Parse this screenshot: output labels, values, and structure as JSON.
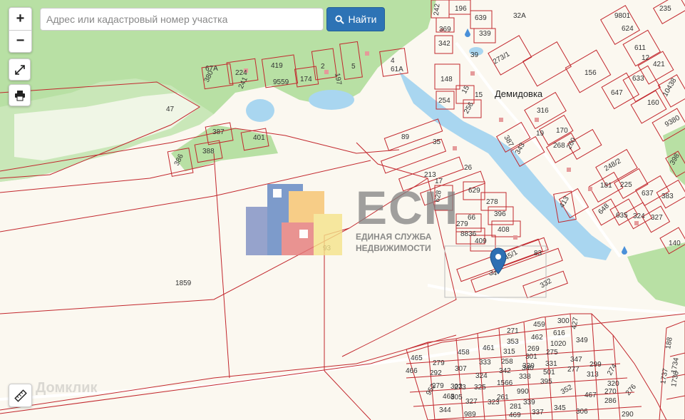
{
  "search": {
    "placeholder": "Адрес или кадастровый номер участка",
    "button_label": "Найти"
  },
  "controls": {
    "zoom_in": "+",
    "zoom_out": "−"
  },
  "map": {
    "place_name": "Демидовка",
    "plots": [
      {
        "id": "p1",
        "label": "47"
      },
      {
        "id": "p2",
        "label": "67A"
      },
      {
        "id": "p3",
        "label": "380"
      },
      {
        "id": "p4",
        "label": "224"
      },
      {
        "id": "p5",
        "label": "241"
      },
      {
        "id": "p6",
        "label": "419"
      },
      {
        "id": "p7",
        "label": "9559"
      },
      {
        "id": "p8",
        "label": "174"
      },
      {
        "id": "p9",
        "label": "2"
      },
      {
        "id": "p10",
        "label": "197"
      },
      {
        "id": "p11",
        "label": "5"
      },
      {
        "id": "p12",
        "label": "4"
      },
      {
        "id": "p13",
        "label": "61A"
      },
      {
        "id": "p14",
        "label": "387"
      },
      {
        "id": "p15",
        "label": "401"
      },
      {
        "id": "p16",
        "label": "388"
      },
      {
        "id": "p17",
        "label": "386"
      },
      {
        "id": "p18",
        "label": "242"
      },
      {
        "id": "p19",
        "label": "196"
      },
      {
        "id": "p20",
        "label": "639"
      },
      {
        "id": "p21",
        "label": "369"
      },
      {
        "id": "p22",
        "label": "339"
      },
      {
        "id": "p23",
        "label": "342"
      },
      {
        "id": "p24",
        "label": "39"
      },
      {
        "id": "p25",
        "label": "273/1"
      },
      {
        "id": "p26",
        "label": "148"
      },
      {
        "id": "p27",
        "label": "254"
      },
      {
        "id": "p28",
        "label": "15"
      },
      {
        "id": "p29",
        "label": "256"
      },
      {
        "id": "p30",
        "label": "32A"
      },
      {
        "id": "p31",
        "label": "9801"
      },
      {
        "id": "p32",
        "label": "624"
      },
      {
        "id": "p33",
        "label": "611"
      },
      {
        "id": "p34",
        "label": "12"
      },
      {
        "id": "p35",
        "label": "421"
      },
      {
        "id": "p36",
        "label": "156"
      },
      {
        "id": "p37",
        "label": "647"
      },
      {
        "id": "p38",
        "label": "633"
      },
      {
        "id": "p39",
        "label": "10438"
      },
      {
        "id": "p40",
        "label": "235"
      },
      {
        "id": "p41",
        "label": "316"
      },
      {
        "id": "p42",
        "label": "160"
      },
      {
        "id": "p43",
        "label": "9380"
      },
      {
        "id": "p44",
        "label": "387"
      },
      {
        "id": "p45",
        "label": "170"
      },
      {
        "id": "p46",
        "label": "19"
      },
      {
        "id": "p47",
        "label": "343"
      },
      {
        "id": "p48",
        "label": "268"
      },
      {
        "id": "p49",
        "label": "260"
      },
      {
        "id": "p50",
        "label": "248/2"
      },
      {
        "id": "p51",
        "label": "398"
      },
      {
        "id": "p52",
        "label": "89"
      },
      {
        "id": "p53",
        "label": "213"
      },
      {
        "id": "p54",
        "label": "17"
      },
      {
        "id": "p55",
        "label": "628"
      },
      {
        "id": "p56",
        "label": "629"
      },
      {
        "id": "p57",
        "label": "278"
      },
      {
        "id": "p58",
        "label": "279"
      },
      {
        "id": "p59",
        "label": "396"
      },
      {
        "id": "p60",
        "label": "8836"
      },
      {
        "id": "p61",
        "label": "408"
      },
      {
        "id": "p62",
        "label": "409"
      },
      {
        "id": "p63",
        "label": "181"
      },
      {
        "id": "p64",
        "label": "225"
      },
      {
        "id": "p65",
        "label": "637"
      },
      {
        "id": "p66",
        "label": "383"
      },
      {
        "id": "p67",
        "label": "413"
      },
      {
        "id": "p68",
        "label": "648"
      },
      {
        "id": "p69",
        "label": "635"
      },
      {
        "id": "p70",
        "label": "324"
      },
      {
        "id": "p71",
        "label": "327"
      },
      {
        "id": "p72",
        "label": "140"
      },
      {
        "id": "p73",
        "label": "93"
      },
      {
        "id": "p74",
        "label": "83"
      },
      {
        "id": "p75",
        "label": "345/1"
      },
      {
        "id": "p76",
        "label": "34"
      },
      {
        "id": "p77",
        "label": "332"
      },
      {
        "id": "p78",
        "label": "1859"
      },
      {
        "id": "p79",
        "label": "459"
      },
      {
        "id": "p80",
        "label": "300"
      },
      {
        "id": "p81",
        "label": "427"
      },
      {
        "id": "p82",
        "label": "271"
      },
      {
        "id": "p83",
        "label": "462"
      },
      {
        "id": "p84",
        "label": "616"
      },
      {
        "id": "p85",
        "label": "349"
      },
      {
        "id": "p86",
        "label": "353"
      },
      {
        "id": "p87",
        "label": "269"
      },
      {
        "id": "p88",
        "label": "1020"
      },
      {
        "id": "p89",
        "label": "461"
      },
      {
        "id": "p90",
        "label": "315"
      },
      {
        "id": "p91",
        "label": "275"
      },
      {
        "id": "p92",
        "label": "458"
      },
      {
        "id": "p93",
        "label": "301"
      },
      {
        "id": "p94",
        "label": "347"
      },
      {
        "id": "p95",
        "label": "299"
      },
      {
        "id": "p96",
        "label": "465"
      },
      {
        "id": "p97",
        "label": "279"
      },
      {
        "id": "p98",
        "label": "258"
      },
      {
        "id": "p99",
        "label": "330"
      },
      {
        "id": "p100",
        "label": "331"
      },
      {
        "id": "p101",
        "label": "277"
      },
      {
        "id": "p102",
        "label": "333"
      },
      {
        "id": "p103",
        "label": "307"
      },
      {
        "id": "p104",
        "label": "342"
      },
      {
        "id": "p105",
        "label": "340"
      },
      {
        "id": "p106",
        "label": "501"
      },
      {
        "id": "p107",
        "label": "313"
      },
      {
        "id": "p108",
        "label": "274"
      },
      {
        "id": "p109",
        "label": "466"
      },
      {
        "id": "p110",
        "label": "292"
      },
      {
        "id": "p111",
        "label": "324"
      },
      {
        "id": "p112",
        "label": "338"
      },
      {
        "id": "p113",
        "label": "395"
      },
      {
        "id": "p114",
        "label": "279"
      },
      {
        "id": "p115",
        "label": "320"
      },
      {
        "id": "p116",
        "label": "1737"
      },
      {
        "id": "p117",
        "label": "1734"
      },
      {
        "id": "p118",
        "label": "188"
      },
      {
        "id": "p119",
        "label": "273"
      },
      {
        "id": "p120",
        "label": "1566"
      },
      {
        "id": "p121",
        "label": "325"
      },
      {
        "id": "p122",
        "label": "990"
      },
      {
        "id": "p123",
        "label": "352"
      },
      {
        "id": "p124",
        "label": "270"
      },
      {
        "id": "p125",
        "label": "276"
      },
      {
        "id": "p126",
        "label": "303"
      },
      {
        "id": "p127",
        "label": "305"
      },
      {
        "id": "p128",
        "label": "261"
      },
      {
        "id": "p129",
        "label": "339"
      },
      {
        "id": "p130",
        "label": "467"
      },
      {
        "id": "p131",
        "label": "1736"
      },
      {
        "id": "p132",
        "label": "952"
      },
      {
        "id": "p133",
        "label": "468"
      },
      {
        "id": "p134",
        "label": "327"
      },
      {
        "id": "p135",
        "label": "323"
      },
      {
        "id": "p136",
        "label": "281"
      },
      {
        "id": "p137",
        "label": "345"
      },
      {
        "id": "p138",
        "label": "286"
      },
      {
        "id": "p139",
        "label": "344"
      },
      {
        "id": "p140",
        "label": "989"
      },
      {
        "id": "p141",
        "label": "469"
      },
      {
        "id": "p142",
        "label": "337"
      },
      {
        "id": "p143",
        "label": "306"
      },
      {
        "id": "p144",
        "label": "290"
      },
      {
        "id": "p145",
        "label": "15"
      },
      {
        "id": "p146",
        "label": "66"
      },
      {
        "id": "p147",
        "label": "26"
      },
      {
        "id": "p148",
        "label": "35"
      }
    ]
  },
  "logo": {
    "title": "ЕСН",
    "line1": "ЕДИНАЯ СЛУЖБА",
    "line2": "НЕДВИЖИМОСТИ"
  },
  "watermark": "Домклик",
  "colors": {
    "forest": "#b8e0a4",
    "water": "#a9d6f0",
    "plot_border": "#c2272d",
    "background": "#fbf8f0",
    "button": "#2d73b5",
    "marker": "#2e6fb3"
  },
  "icons": {
    "zoom_in": "plus-icon",
    "zoom_out": "minus-icon",
    "fullscreen": "expand-icon",
    "print": "printer-icon",
    "search": "search-icon",
    "measure": "ruler-icon",
    "marker": "map-pin-icon"
  }
}
